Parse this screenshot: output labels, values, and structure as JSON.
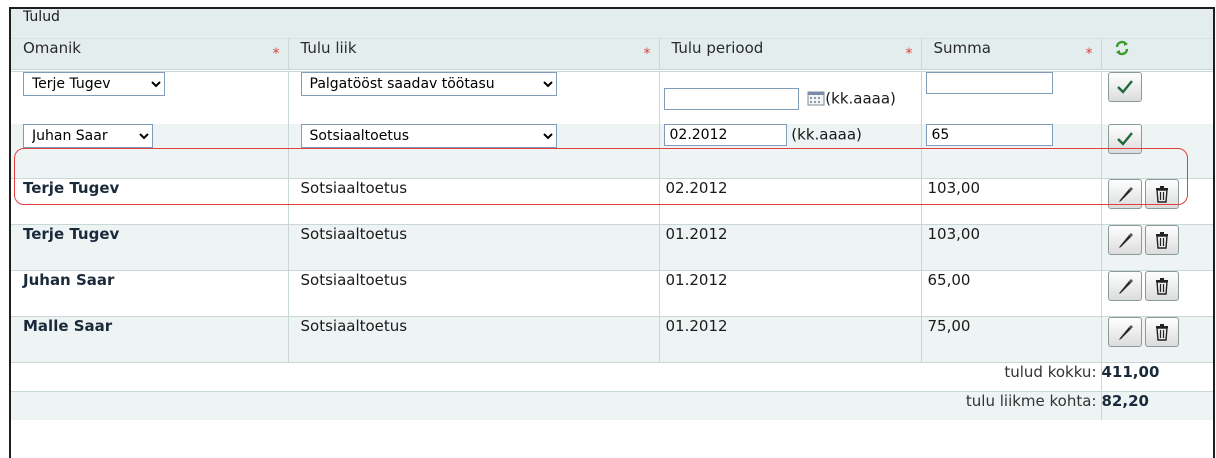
{
  "table": {
    "caption": "Tulud",
    "columns": {
      "owner": "Omanik",
      "type": "Tulu liik",
      "period": "Tulu periood",
      "sum": "Summa",
      "required_mark": "*"
    },
    "new_row": {
      "owner": "Terje Tugev",
      "type": "Palgatööst saadav töötasu",
      "period": "",
      "period_hint": "(kk.aaaa)",
      "sum": ""
    },
    "edit_row": {
      "owner": "Juhan Saar",
      "type": "Sotsiaaltoetus",
      "period": "02.2012",
      "period_hint": "(kk.aaaa)",
      "sum": "65"
    },
    "rows": [
      {
        "owner": "Terje Tugev",
        "type": "Sotsiaaltoetus",
        "period": "02.2012",
        "sum": "103,00"
      },
      {
        "owner": "Terje Tugev",
        "type": "Sotsiaaltoetus",
        "period": "01.2012",
        "sum": "103,00"
      },
      {
        "owner": "Juhan Saar",
        "type": "Sotsiaaltoetus",
        "period": "01.2012",
        "sum": "65,00"
      },
      {
        "owner": "Malle Saar",
        "type": "Sotsiaaltoetus",
        "period": "01.2012",
        "sum": "75,00"
      }
    ],
    "totals": {
      "total_label": "tulud kokku:",
      "total_value": "411,00",
      "per_member_label": "tulu liikme kohta:",
      "per_member_value": "82,20"
    }
  },
  "icons": {
    "refresh": "refresh-icon",
    "calendar": "calendar-icon",
    "confirm": "checkmark-icon",
    "edit": "pencil-icon",
    "delete": "trash-icon"
  },
  "colors": {
    "header_bg": "#e3eded",
    "alt_row_bg": "#eef4f4",
    "required_star": "#e04040",
    "highlight_border": "#e04040",
    "check_green": "#1f8a3a"
  }
}
